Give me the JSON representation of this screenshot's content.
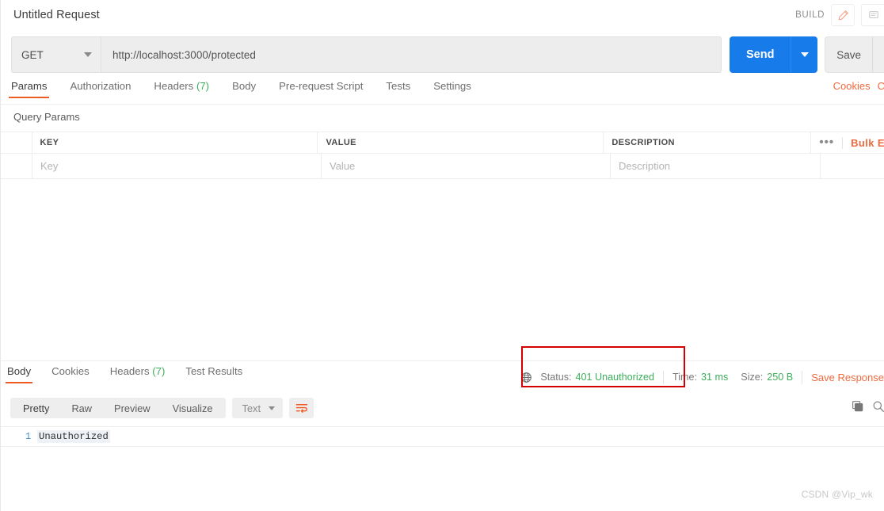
{
  "header": {
    "request_title": "Untitled Request",
    "build_label": "BUILD",
    "edit_icon": "pencil-icon",
    "comment_icon": "comment-icon"
  },
  "url_bar": {
    "method": "GET",
    "url": "http://localhost:3000/protected",
    "send_label": "Send",
    "save_label": "Save"
  },
  "request_tabs": {
    "items": [
      {
        "label": "Params",
        "count": "",
        "active": true
      },
      {
        "label": "Authorization",
        "count": "",
        "active": false
      },
      {
        "label": "Headers",
        "count": "(7)",
        "active": false
      },
      {
        "label": "Body",
        "count": "",
        "active": false
      },
      {
        "label": "Pre-request Script",
        "count": "",
        "active": false
      },
      {
        "label": "Tests",
        "count": "",
        "active": false
      },
      {
        "label": "Settings",
        "count": "",
        "active": false
      }
    ],
    "cookies_link": "Cookies",
    "code_link": "C"
  },
  "query_params": {
    "section_label": "Query Params",
    "columns": [
      "KEY",
      "VALUE",
      "DESCRIPTION"
    ],
    "rows": [
      {
        "key": "Key",
        "value": "Value",
        "description": "Description"
      }
    ],
    "more_icon": "ellipsis-icon",
    "bulk_edit_label": "Bulk E"
  },
  "response": {
    "tabs": [
      {
        "label": "Body",
        "count": "",
        "active": true
      },
      {
        "label": "Cookies",
        "count": "",
        "active": false
      },
      {
        "label": "Headers",
        "count": "(7)",
        "active": false
      },
      {
        "label": "Test Results",
        "count": "",
        "active": false
      }
    ],
    "globe_icon": "globe-icon",
    "status_label": "Status:",
    "status_value": "401 Unauthorized",
    "time_label": "Time:",
    "time_value": "31 ms",
    "size_label": "Size:",
    "size_value": "250 B",
    "save_response_label": "Save Response",
    "status_color": "#3dae5a",
    "highlight_box_color": "#d40000"
  },
  "viewer": {
    "view_modes": [
      {
        "label": "Pretty",
        "active": true
      },
      {
        "label": "Raw",
        "active": false
      },
      {
        "label": "Preview",
        "active": false
      },
      {
        "label": "Visualize",
        "active": false
      }
    ],
    "content_type": "Text",
    "wrap_icon": "wrap-lines-icon",
    "copy_icon": "copy-icon",
    "search_icon": "search-icon"
  },
  "body_content": {
    "lines": [
      {
        "number": "1",
        "text": "Unauthorized"
      }
    ]
  },
  "watermark": {
    "text": "CSDN @Vip_wk"
  },
  "theme": {
    "accent_orange": "#ef5b25",
    "send_blue": "#177bea",
    "success_green": "#3dae5a",
    "link_orange": "#f06a3f"
  }
}
